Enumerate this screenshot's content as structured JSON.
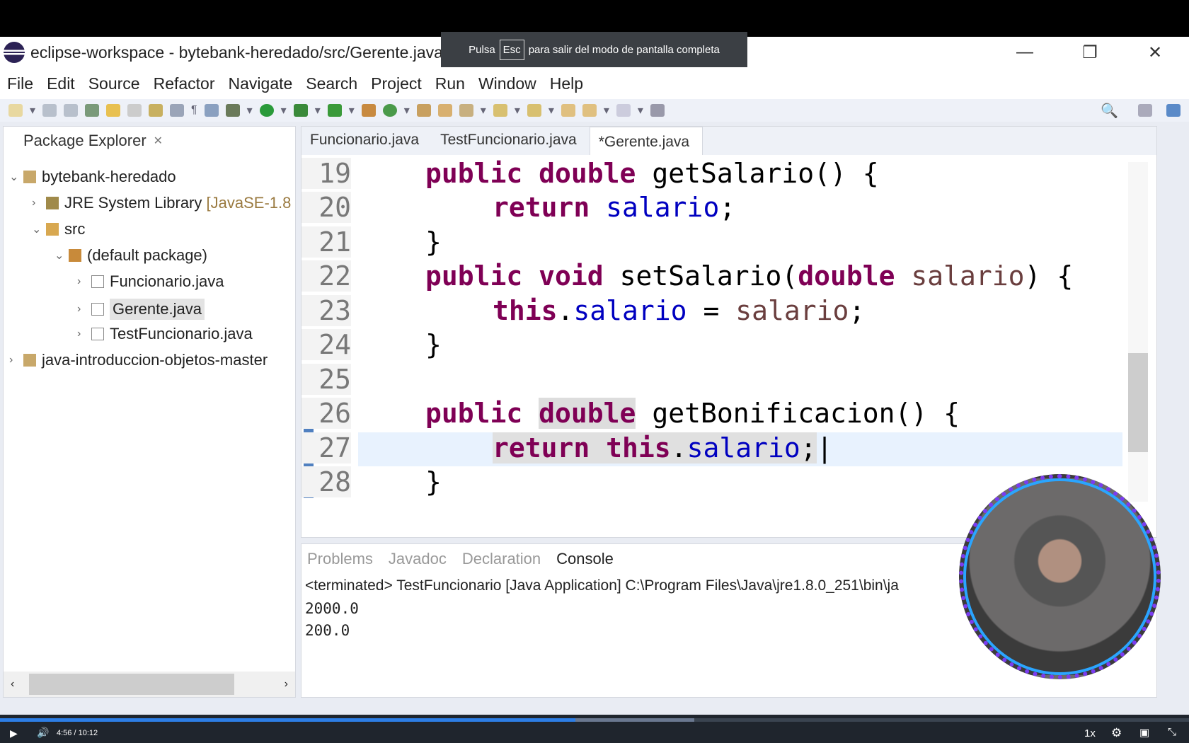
{
  "window": {
    "title": "eclipse-workspace - bytebank-heredado/src/Gerente.java - Eclipse IDE"
  },
  "toast": {
    "pre": "Pulsa",
    "key": "Esc",
    "post": "para salir del modo de pantalla completa"
  },
  "menu": [
    "File",
    "Edit",
    "Source",
    "Refactor",
    "Navigate",
    "Search",
    "Project",
    "Run",
    "Window",
    "Help"
  ],
  "package_explorer": {
    "title": "Package Explorer",
    "tree": [
      {
        "label": "bytebank-heredado",
        "extra": ""
      },
      {
        "label": "JRE System Library",
        "extra": "[JavaSE-1.8"
      },
      {
        "label": "src",
        "extra": ""
      },
      {
        "label": "(default package)",
        "extra": ""
      },
      {
        "label": "Funcionario.java",
        "extra": ""
      },
      {
        "label": "Gerente.java",
        "extra": ""
      },
      {
        "label": "TestFuncionario.java",
        "extra": ""
      },
      {
        "label": "java-introduccion-objetos-master",
        "extra": ""
      }
    ]
  },
  "editor": {
    "tabs": [
      "Funcionario.java",
      "TestFuncionario.java",
      "*Gerente.java"
    ],
    "line_numbers": [
      "19",
      "20",
      "21",
      "22",
      "23",
      "24",
      "25",
      "26",
      "27",
      "28"
    ]
  },
  "console": {
    "tabs": [
      "Problems",
      "Javadoc",
      "Declaration",
      "Console"
    ],
    "status": "<terminated> TestFuncionario [Java Application] C:\\Program Files\\Java\\jre1.8.0_251\\bin\\ja",
    "output": [
      "2000.0",
      "200.0"
    ]
  },
  "video": {
    "current": "4:56",
    "duration": "10:12",
    "speed": "1x",
    "progress_percent": 48.4,
    "buffered_percent": 58.4
  },
  "colors": {
    "keyword": "#7f0055",
    "field": "#0000c0",
    "progress": "#2d7ee6"
  }
}
